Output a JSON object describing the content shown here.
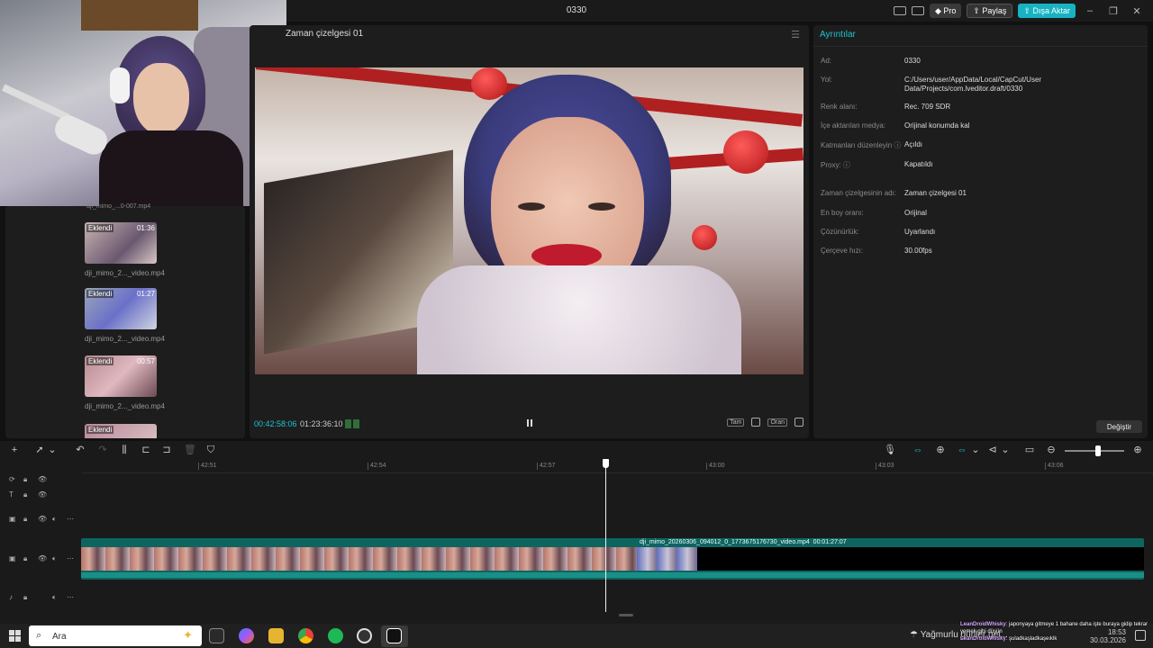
{
  "window": {
    "title": "0330",
    "pro_label": "Pro",
    "share_label": "Paylaş",
    "export_label": "Dışa Aktar"
  },
  "media": {
    "top_name": "dji_mimo_...0-007.mp4",
    "items": [
      {
        "badge": "Eklendi",
        "duration": "01:36",
        "name": "dji_mimo_2..._video.mp4"
      },
      {
        "badge": "Eklendi",
        "duration": "01:27",
        "name": "dji_mimo_2..._video.mp4"
      },
      {
        "badge": "Eklendi",
        "duration": "00:57",
        "name": "dji_mimo_2..._video.mp4"
      },
      {
        "badge": "Eklendi",
        "duration": "",
        "name": ""
      }
    ]
  },
  "player": {
    "title": "Zaman çizelgesi 01",
    "current_time": "00:42:58:06",
    "total_time": "01:23:36:10",
    "full_label": "Tam",
    "ratio_label": "Oran"
  },
  "details": {
    "title": "Ayrıntılar",
    "rows": [
      {
        "key": "Ad:",
        "value": "0330"
      },
      {
        "key": "Yol:",
        "value": "C:/Users/user/AppData/Local/CapCut/User Data/Projects/com.lveditor.draft/0330"
      },
      {
        "key": "Renk alanı:",
        "value": "Rec. 709 SDR"
      },
      {
        "key": "İçe aktarılan medya:",
        "value": "Orijinal konumda kal"
      },
      {
        "key": "Katmanları düzenleyin ⓘ",
        "value": "Açıldı"
      },
      {
        "key": "Proxy: ⓘ",
        "value": "Kapatıldı"
      },
      {
        "key": "Zaman çizelgesinin adı:",
        "value": "Zaman çizelgesi 01"
      },
      {
        "key": "En boy oranı:",
        "value": "Orijinal"
      },
      {
        "key": "Çözünürlük:",
        "value": "Uyarlandı"
      },
      {
        "key": "Çerçeve hızı:",
        "value": "30.00fps"
      }
    ],
    "change_label": "Değiştir"
  },
  "timeline": {
    "ruler": [
      "42:51",
      "42:54",
      "42:57",
      "43:00",
      "43:03",
      "43:06"
    ],
    "clip_label": "dji_mimo_20260306_094012_0_1773675176730_video.mp4",
    "clip_duration": "00:01:27:07"
  },
  "taskbar": {
    "search_text": "Ara",
    "weather": "Yağmurlu günler gel...",
    "time": "18:53",
    "date": "30.03.2026"
  },
  "chat": [
    {
      "user": "LeanDroidWhisky",
      "text": ": japonyaya gitmeye 1 bahane daha işte buraya gidip tekrar yemek gibi düşün"
    },
    {
      "user": "LeanDroidWhisky",
      "text": ": şuladkaşladkaşeıklk"
    }
  ]
}
